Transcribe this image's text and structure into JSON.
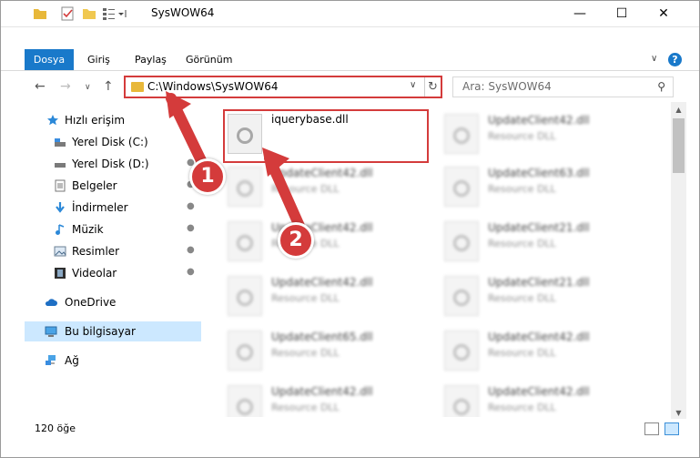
{
  "window": {
    "title": "SysWOW64",
    "minimize": "—",
    "maximize": "☐",
    "close": "✕"
  },
  "ribbon": {
    "tabs": [
      {
        "label": "Dosya"
      },
      {
        "label": "Giriş"
      },
      {
        "label": "Paylaş"
      },
      {
        "label": "Görünüm"
      }
    ],
    "help": "?"
  },
  "address": {
    "path": "C:\\Windows\\SysWOW64",
    "search_placeholder": "Ara: SysWOW64"
  },
  "navpane": {
    "items": [
      {
        "label": "Hızlı erişim",
        "icon": "star-icon"
      },
      {
        "label": "Yerel Disk (C:)",
        "icon": "drive-icon"
      },
      {
        "label": "Yerel Disk (D:)",
        "icon": "drive-icon"
      },
      {
        "label": "Belgeler",
        "icon": "documents-icon"
      },
      {
        "label": "İndirmeler",
        "icon": "download-icon"
      },
      {
        "label": "Müzik",
        "icon": "music-icon"
      },
      {
        "label": "Resimler",
        "icon": "pictures-icon"
      },
      {
        "label": "Videolar",
        "icon": "video-icon"
      },
      {
        "label": "OneDrive",
        "icon": "cloud-icon"
      },
      {
        "label": "Bu bilgisayar",
        "icon": "computer-icon"
      },
      {
        "label": "Ağ",
        "icon": "network-icon"
      }
    ]
  },
  "files": [
    {
      "name": "iquerybase.dll",
      "type": ""
    },
    {
      "name": "UpdateClient42.dll",
      "type": "Resource DLL"
    },
    {
      "name": "UpdateClient42.dll",
      "type": "Resource DLL"
    },
    {
      "name": "UpdateClient63.dll",
      "type": "Resource DLL"
    },
    {
      "name": "UpdateClient42.dll",
      "type": "Resource DLL"
    },
    {
      "name": "UpdateClient21.dll",
      "type": "Resource DLL"
    },
    {
      "name": "UpdateClient42.dll",
      "type": "Resource DLL"
    },
    {
      "name": "UpdateClient21.dll",
      "type": "Resource DLL"
    },
    {
      "name": "UpdateClient65.dll",
      "type": "Resource DLL"
    },
    {
      "name": "UpdateClient42.dll",
      "type": "Resource DLL"
    },
    {
      "name": "UpdateClient42.dll",
      "type": "Resource DLL"
    },
    {
      "name": "UpdateClient42.dll",
      "type": "Resource DLL"
    }
  ],
  "status": {
    "count": "120 öğe"
  },
  "annotations": {
    "step1": "1",
    "step2": "2"
  },
  "colors": {
    "accent": "#1979ca",
    "highlight": "#d43b3b",
    "selected": "#cce8ff"
  }
}
